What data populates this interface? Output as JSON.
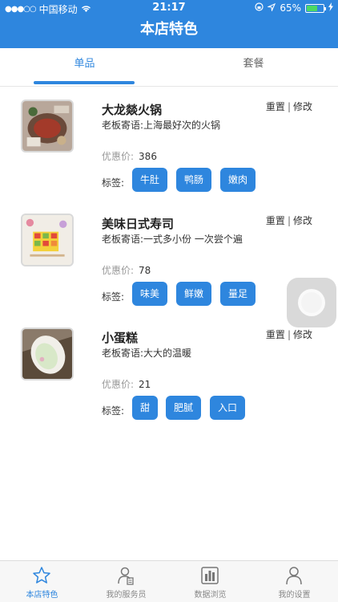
{
  "status_bar": {
    "carrier": "中国移动",
    "time": "21:17",
    "battery": "65%",
    "battery_level": 0.65
  },
  "header": {
    "title": "本店特色"
  },
  "tabs": [
    {
      "label": "单品",
      "active": true
    },
    {
      "label": "套餐",
      "active": false
    }
  ],
  "items": [
    {
      "name": "大龙燚火锅",
      "note": "老板寄语:上海最好次的火锅",
      "price_label": "优惠价:",
      "price": "386",
      "tags_label": "标签:",
      "tags": [
        "牛肚",
        "鸭肠",
        "嫩肉"
      ],
      "reset": "重置",
      "sep": "|",
      "edit": "修改"
    },
    {
      "name": "美味日式寿司",
      "note": "老板寄语:一式多小份 一次尝个遍",
      "price_label": "优惠价:",
      "price": "78",
      "tags_label": "标签:",
      "tags": [
        "味美",
        "鲜嫩",
        "量足"
      ],
      "reset": "重置",
      "sep": "|",
      "edit": "修改"
    },
    {
      "name": "小蛋糕",
      "note": "老板寄语:大大的温暖",
      "price_label": "优惠价:",
      "price": "21",
      "tags_label": "标签:",
      "tags": [
        "甜",
        "肥腻",
        "入口"
      ],
      "reset": "重置",
      "sep": "|",
      "edit": "修改"
    }
  ],
  "bottom_nav": [
    {
      "label": "本店特色",
      "icon": "star-icon",
      "active": true
    },
    {
      "label": "我的服务员",
      "icon": "waiter-icon",
      "active": false
    },
    {
      "label": "数据浏览",
      "icon": "bar-chart-icon",
      "active": false
    },
    {
      "label": "我的设置",
      "icon": "person-icon",
      "active": false
    }
  ],
  "colors": {
    "primary": "#2e86de",
    "tag_bg": "#2e86de"
  }
}
